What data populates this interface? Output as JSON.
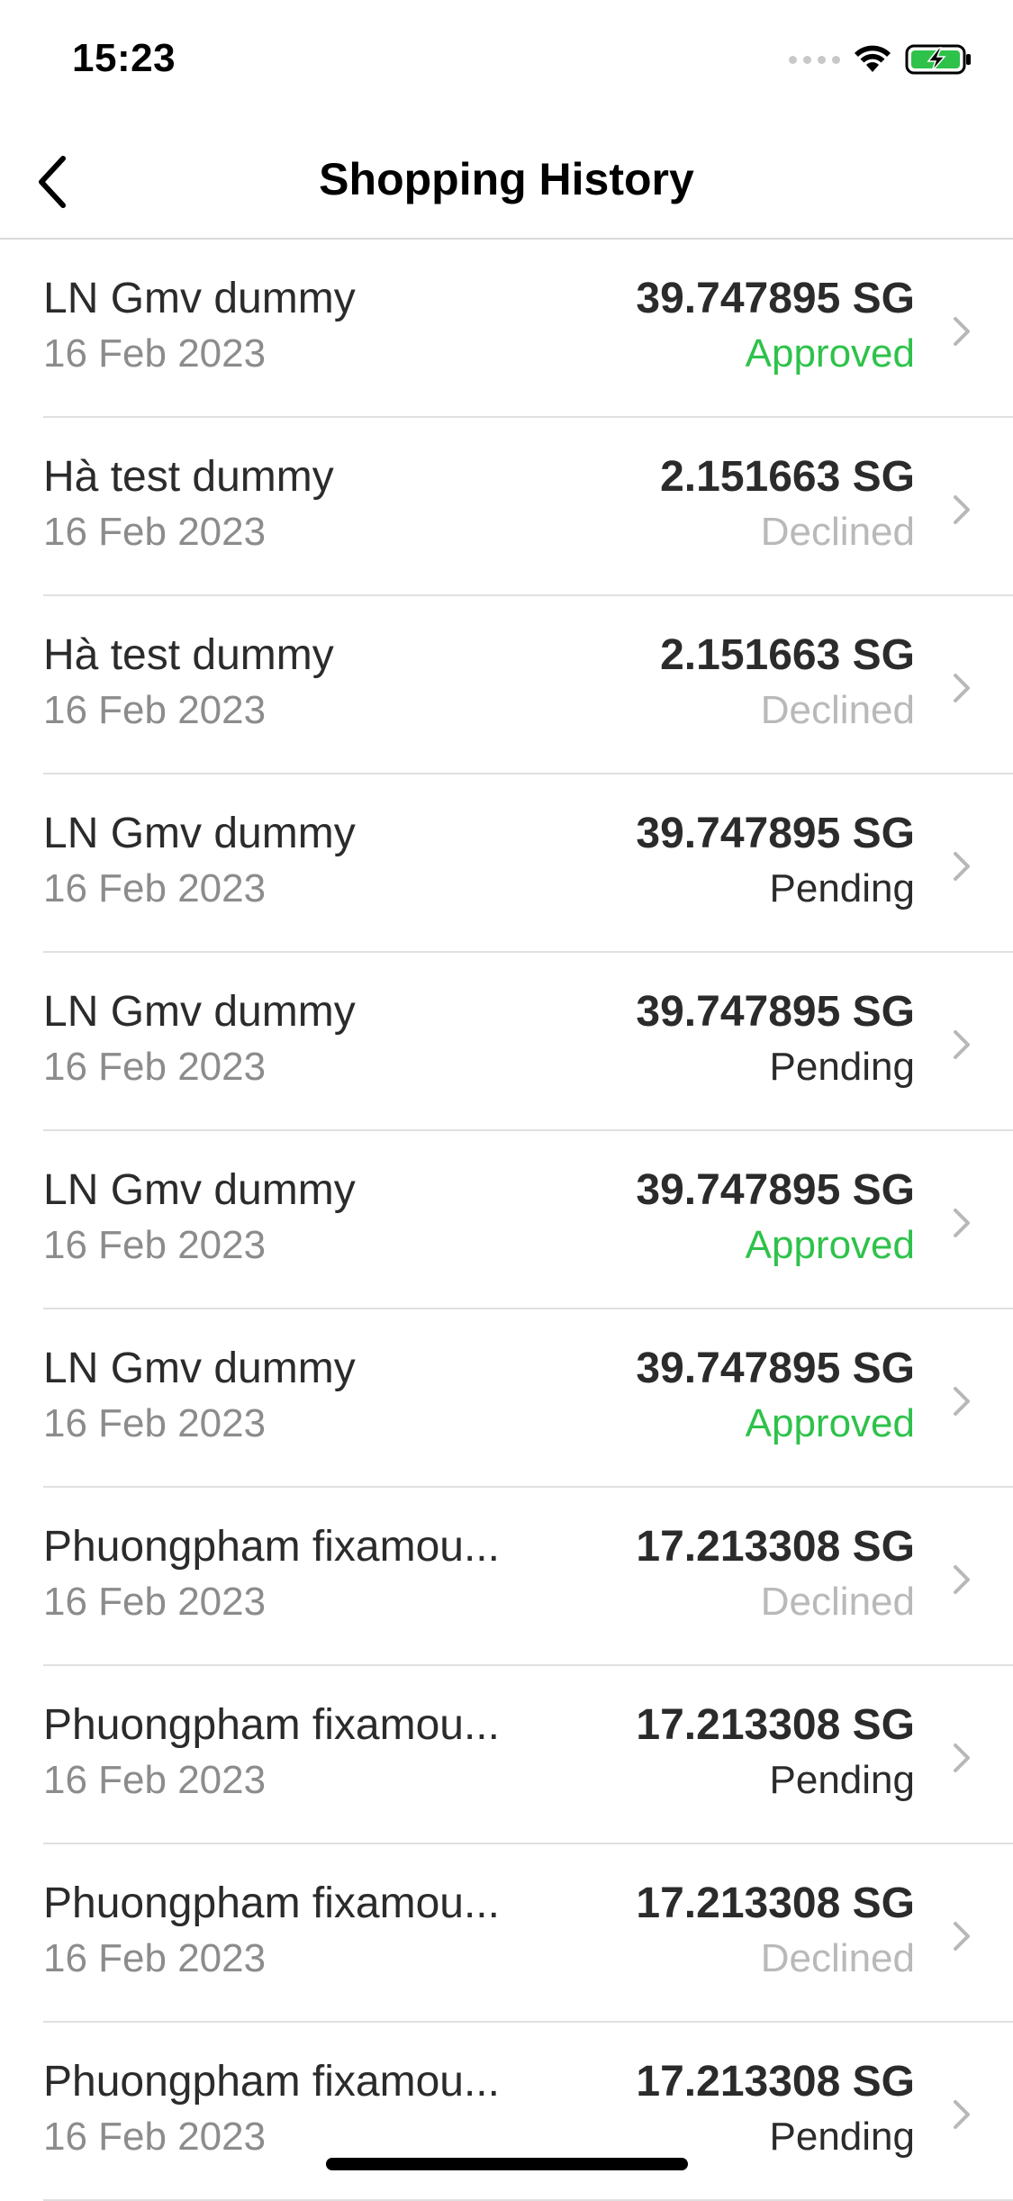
{
  "status_bar": {
    "time": "15:23"
  },
  "nav": {
    "title": "Shopping History",
    "back_icon": "chevron-left-icon"
  },
  "colors": {
    "approved": "#2ec24a",
    "declined": "#b9b9b9",
    "pending": "#2b2b2b"
  },
  "transactions": [
    {
      "title": "LN Gmv dummy",
      "date": "16 Feb 2023",
      "amount": "39.747895 SG",
      "status": "Approved"
    },
    {
      "title": "Hà test dummy",
      "date": "16 Feb 2023",
      "amount": "2.151663 SG",
      "status": "Declined"
    },
    {
      "title": "Hà test dummy",
      "date": "16 Feb 2023",
      "amount": "2.151663 SG",
      "status": "Declined"
    },
    {
      "title": "LN Gmv dummy",
      "date": "16 Feb 2023",
      "amount": "39.747895 SG",
      "status": "Pending"
    },
    {
      "title": "LN Gmv dummy",
      "date": "16 Feb 2023",
      "amount": "39.747895 SG",
      "status": "Pending"
    },
    {
      "title": "LN Gmv dummy",
      "date": "16 Feb 2023",
      "amount": "39.747895 SG",
      "status": "Approved"
    },
    {
      "title": "LN Gmv dummy",
      "date": "16 Feb 2023",
      "amount": "39.747895 SG",
      "status": "Approved"
    },
    {
      "title": "Phuongpham fixamou...",
      "date": "16 Feb 2023",
      "amount": "17.213308 SG",
      "status": "Declined"
    },
    {
      "title": "Phuongpham fixamou...",
      "date": "16 Feb 2023",
      "amount": "17.213308 SG",
      "status": "Pending"
    },
    {
      "title": "Phuongpham fixamou...",
      "date": "16 Feb 2023",
      "amount": "17.213308 SG",
      "status": "Declined"
    },
    {
      "title": "Phuongpham fixamou...",
      "date": "16 Feb 2023",
      "amount": "17.213308 SG",
      "status": "Pending"
    }
  ]
}
